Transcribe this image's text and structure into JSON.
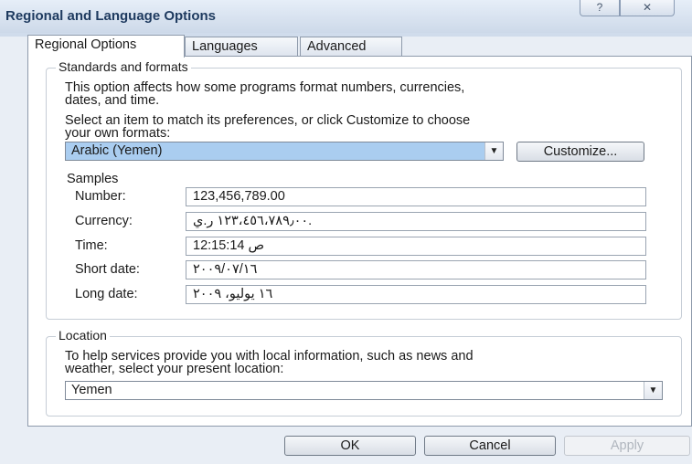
{
  "window": {
    "title": "Regional and Language Options",
    "help_glyph": "?",
    "close_glyph": "✕"
  },
  "tabs": [
    {
      "label": "Regional Options",
      "active": true
    },
    {
      "label": "Languages",
      "active": false
    },
    {
      "label": "Advanced",
      "active": false
    }
  ],
  "standards": {
    "legend": "Standards and formats",
    "description": "This option affects how some programs format numbers, currencies,\ndates, and time.",
    "instruction": "Select an item to match its preferences, or click Customize to choose\nyour own formats:",
    "format_value": "Arabic (Yemen)",
    "customize_label": "Customize...",
    "samples_heading": "Samples",
    "samples": [
      {
        "label": "Number:",
        "value": "123,456,789.00"
      },
      {
        "label": "Currency:",
        "value": "١٢٣،٤٥٦،٧٨٩٫٠٠ ر.ي."
      },
      {
        "label": "Time:",
        "value": "12:15:14 ص"
      },
      {
        "label": "Short date:",
        "value": "٢٠٠٩/٠٧/١٦"
      },
      {
        "label": "Long date:",
        "value": "١٦ يوليو، ٢٠٠٩"
      }
    ]
  },
  "location": {
    "legend": "Location",
    "description": "To help services provide you with local information, such as news and\nweather, select your present location:",
    "value": "Yemen"
  },
  "buttons": {
    "ok": "OK",
    "cancel": "Cancel",
    "apply": "Apply"
  },
  "icons": {
    "dropdown": "chevron-down-icon",
    "help": "help-icon",
    "close": "close-icon"
  }
}
